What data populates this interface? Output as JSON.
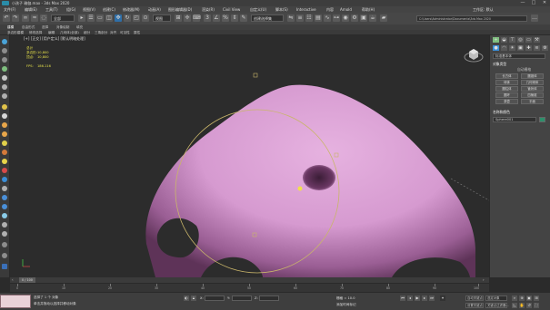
{
  "window": {
    "title": "小孩子 瑜伽.max - 3ds Max 2020",
    "controls": [
      "—",
      "□",
      "✕"
    ]
  },
  "menu": {
    "items": [
      "文件(F)",
      "编辑(E)",
      "工具(T)",
      "组(G)",
      "视图(V)",
      "创建(C)",
      "修改器(M)",
      "动画(A)",
      "图形编辑器(D)",
      "渲染(R)",
      "Civil View",
      "自定义(U)",
      "脚本(S)",
      "Interactive",
      "内容",
      "Arnold",
      "帮助(H)"
    ],
    "workspace_label": "工作区: 默认"
  },
  "toolbar": {
    "selection_filter": "全部",
    "view_dropdown": "视图",
    "named_selection": "创建选择集",
    "path": "C:\\Users\\Administrator\\Documents\\3ds Max 2020"
  },
  "ribbon": {
    "row1": [
      "建模",
      "自由形式",
      "选择",
      "对象绘制",
      "填充"
    ],
    "row2": [
      "多边形建模",
      "修改选择",
      "编辑",
      "几何体(全部)",
      "细分",
      "三角剖分",
      "对齐",
      "可见性",
      "属性"
    ]
  },
  "viewport": {
    "label": "[+] [正交] [用户定义] [默认明暗处理]",
    "stats": [
      {
        "label": "总计",
        "value": ""
      },
      {
        "label": "多边形:",
        "value": "10,800"
      },
      {
        "label": "顶点:",
        "value": "10,800"
      },
      {
        "label": "FPS:",
        "value": "186.116"
      }
    ],
    "mesh_color": "#d69ad0",
    "gizmo_color": "#c9b56a"
  },
  "command_panel": {
    "dropdown": "标准基本体",
    "section_object_type": "对象类型",
    "autogrid_label": "自动栅格",
    "object_buttons": [
      "长方体",
      "圆锥体",
      "球体",
      "几何球体",
      "圆柱体",
      "管状体",
      "圆环",
      "四棱锥",
      "茶壶",
      "平面"
    ],
    "section_name_color": "名称和颜色",
    "name_value": "Sphere001",
    "color_swatch": "#2d8f6b"
  },
  "timeline": {
    "counter": "0 / 100",
    "ticks": [
      "0",
      "10",
      "20",
      "30",
      "40",
      "50",
      "60",
      "70",
      "80",
      "90",
      "100"
    ]
  },
  "statusbar": {
    "selection": "选择了 1 个 对象",
    "prompt": "单击并拖动以选择并移动对象",
    "x_label": "X:",
    "x_value": "",
    "y_label": "Y:",
    "y_value": "",
    "z_label": "Z:",
    "z_value": "",
    "grid_label": "栅格 = 10.0",
    "add_time_tag": "添加时间标记",
    "auto_key": "自动关键点",
    "set_key": "设置关键点",
    "key_filter": "选定对象",
    "key_filters_btn": "关键点过滤器..."
  }
}
